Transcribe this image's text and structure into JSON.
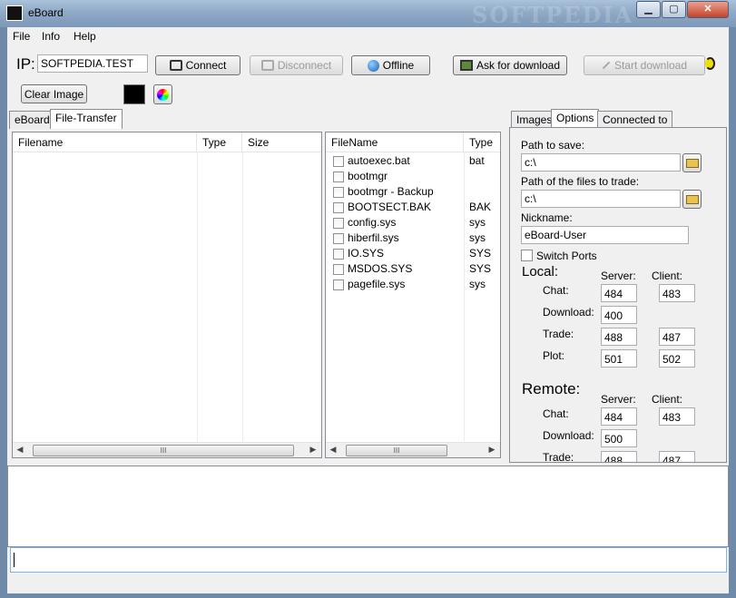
{
  "window": {
    "title": "eBoard",
    "watermark": "SOFTPEDIA",
    "min": "▁",
    "max": "▢",
    "close": "✕"
  },
  "menu": [
    "File",
    "Info",
    "Help"
  ],
  "toolbar": {
    "ip_label": "IP:",
    "ip_value": "SOFTPEDIA.TEST",
    "connect": "Connect",
    "disconnect": "Disconnect",
    "offline": "Offline",
    "ask_download": "Ask for download",
    "start_download": "Start download"
  },
  "second_bar": {
    "clear_image": "Clear Image",
    "color_swatch": "#000000"
  },
  "left_tabs": [
    "eBoard",
    "File-Transfer"
  ],
  "local_files": {
    "headers": [
      "Filename",
      "Type",
      "Size"
    ],
    "rows": []
  },
  "remote_files": {
    "headers": [
      "FileName",
      "Type"
    ],
    "rows": [
      {
        "name": "autoexec.bat",
        "type": "bat"
      },
      {
        "name": "bootmgr",
        "type": ""
      },
      {
        "name": "bootmgr - Backup",
        "type": ""
      },
      {
        "name": "BOOTSECT.BAK",
        "type": "BAK"
      },
      {
        "name": "config.sys",
        "type": "sys"
      },
      {
        "name": "hiberfil.sys",
        "type": "sys"
      },
      {
        "name": "IO.SYS",
        "type": "SYS"
      },
      {
        "name": "MSDOS.SYS",
        "type": "SYS"
      },
      {
        "name": "pagefile.sys",
        "type": "sys"
      }
    ]
  },
  "right_tabs": [
    "Images",
    "Options",
    "Connected to"
  ],
  "options": {
    "path_save_label": "Path to save:",
    "path_save_value": "c:\\",
    "path_trade_label": "Path of the files to trade:",
    "path_trade_value": "c:\\",
    "nickname_label": "Nickname:",
    "nickname_value": "eBoard-User",
    "switch_ports": "Switch Ports",
    "local": {
      "title": "Local:",
      "server": "Server:",
      "client": "Client:",
      "chat": "Chat:",
      "chat_server": "484",
      "chat_client": "483",
      "download": "Download:",
      "download_server": "400",
      "trade": "Trade:",
      "trade_server": "488",
      "trade_client": "487",
      "plot": "Plot:",
      "plot_server": "501",
      "plot_client": "502"
    },
    "remote": {
      "title": "Remote:",
      "server": "Server:",
      "client": "Client:",
      "chat": "Chat:",
      "chat_server": "484",
      "chat_client": "483",
      "download": "Download:",
      "download_server": "500",
      "trade": "Trade:",
      "trade_server": "488",
      "trade_client": "487"
    }
  },
  "scroll_thumb": "III"
}
